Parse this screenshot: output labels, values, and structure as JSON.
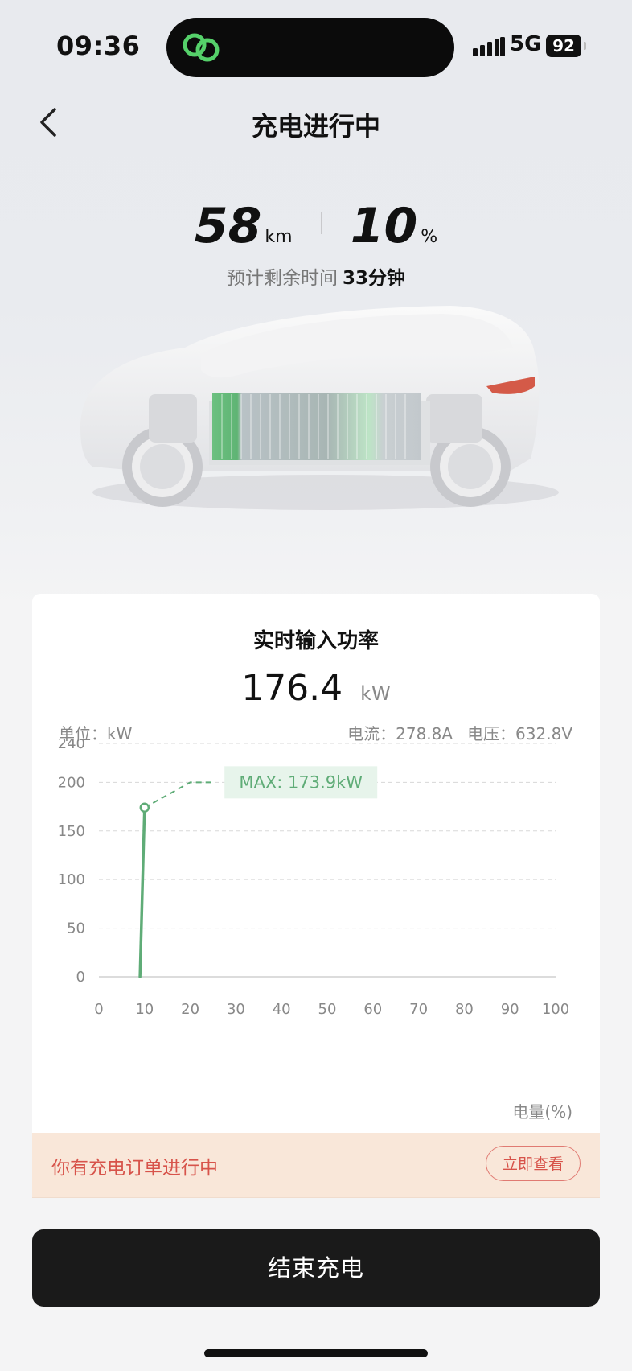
{
  "status_bar": {
    "time": "09:36",
    "network": "5G",
    "battery": "92"
  },
  "nav": {
    "title": "充电进行中"
  },
  "summary": {
    "range_value": "58",
    "range_unit": "km",
    "soc_value": "10",
    "soc_unit": "%",
    "remaining_label": "预计剩余时间",
    "remaining_value": "33分钟"
  },
  "power_card": {
    "title": "实时输入功率",
    "power_value": "176.4",
    "power_unit": "kW",
    "unit_label": "单位：kW",
    "current": "电流：278.8A",
    "voltage": "电压：632.8V",
    "x_axis_label": "电量(%)"
  },
  "chart_data": {
    "type": "line",
    "ylim": [
      0,
      240
    ],
    "xlim": [
      0,
      100
    ],
    "y_ticks": [
      0,
      50,
      100,
      150,
      200,
      240
    ],
    "x_ticks": [
      0,
      10,
      20,
      30,
      40,
      50,
      60,
      70,
      80,
      90,
      100
    ],
    "xlabel": "电量(%)",
    "ylabel": "单位：kW",
    "series": [
      {
        "x": [
          9,
          10
        ],
        "y": [
          0,
          174
        ]
      }
    ],
    "max_line": {
      "x": [
        10,
        20,
        25
      ],
      "y": [
        174,
        200,
        200
      ]
    },
    "max_label": "MAX: 173.9kW",
    "grid": true,
    "colors": {
      "line": "#5fac77",
      "max_bg": "#e7f4eb",
      "grid": "#d8d8d8"
    }
  },
  "order": {
    "text": "你有充电订单进行中",
    "button": "立即查看"
  },
  "end_button": "结束充电"
}
